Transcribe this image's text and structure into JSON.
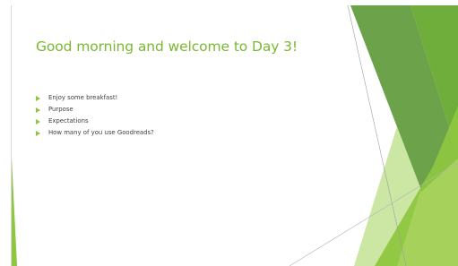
{
  "slide": {
    "title": "Good morning and welcome to Day 3!",
    "bullets": [
      "Enjoy some breakfast!",
      "Purpose",
      "Expectations",
      "How many of you use Goodreads?"
    ]
  },
  "theme": {
    "title_color": "#7ab831",
    "bullet_marker_color": "#8dc63f",
    "decoration_colors": [
      "#5e9a3b",
      "#8dc63f",
      "#6fae3b",
      "#b7dc7e",
      "#a6d25c"
    ]
  },
  "icons": {
    "bullet_marker": "green-triangle-arrow"
  }
}
